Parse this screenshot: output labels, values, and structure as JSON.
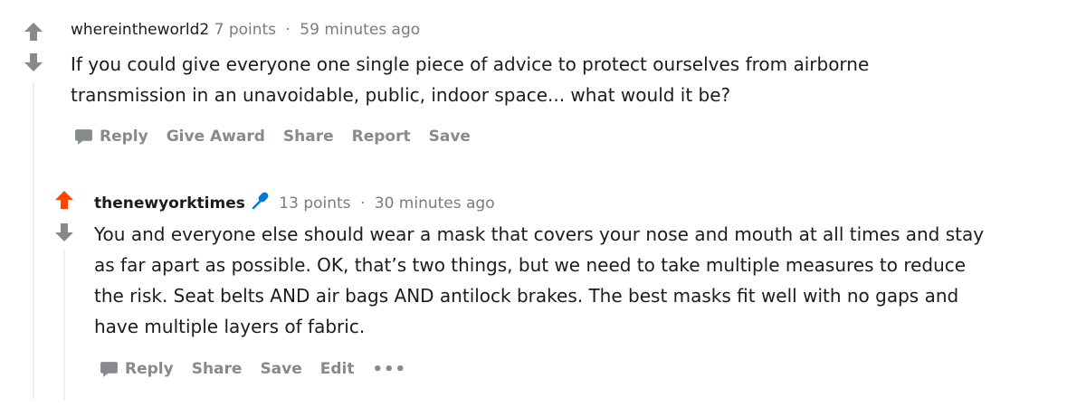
{
  "comments": [
    {
      "author": "whereintheworld2",
      "points": "7 points",
      "separator": "·",
      "time": "59 minutes ago",
      "body": "If you could give everyone one single piece of advice to protect ourselves from airborne transmission in an unavoidable, public, indoor space... what would it be?",
      "upvoted": false,
      "actions": [
        "Reply",
        "Give Award",
        "Share",
        "Report",
        "Save"
      ]
    },
    {
      "author": "thenewyorktimes",
      "author_icon": "microphone-icon",
      "points": "13 points",
      "separator": "·",
      "time": "30 minutes ago",
      "body": "You and everyone else should wear a mask that covers your nose and mouth at all times and stay as far apart as possible. OK, that’s two things, but we need to take multiple measures to reduce the risk. Seat belts AND air bags AND antilock brakes. The best masks fit well with no gaps and have multiple layers of fabric.",
      "upvoted": true,
      "actions": [
        "Reply",
        "Share",
        "Save",
        "Edit"
      ],
      "more": "•••"
    }
  ],
  "colors": {
    "upvote_active": "#ff4500",
    "arrow_neutral": "#878a8c",
    "mic_blue": "#0079d3",
    "muted_text": "#7c7c7c",
    "body_text": "#1c1c1c"
  }
}
